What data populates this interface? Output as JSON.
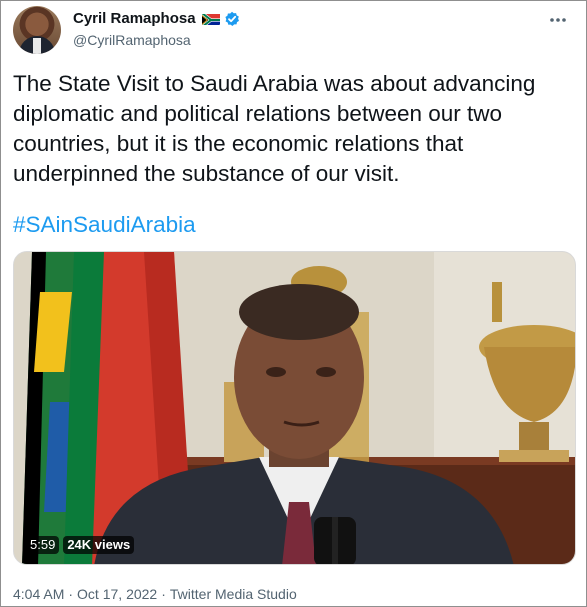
{
  "author": {
    "name": "Cyril Ramaphosa",
    "handle": "@CyrilRamaphosa",
    "flag_icon": "south-africa-flag-icon",
    "verified_icon": "verified-badge-icon"
  },
  "more_menu_icon": "more-options-icon",
  "tweet": {
    "text": "The State Visit to Saudi Arabia was about advancing diplomatic and political relations between our two countries, but it is the economic relations that underpinned the substance of our visit.",
    "hashtag": "#SAinSaudiArabia"
  },
  "media": {
    "duration": "5:59",
    "views": "24K views"
  },
  "meta": {
    "time": "4:04 AM",
    "separator1": "·",
    "date": "Oct 17, 2022",
    "separator2": "·",
    "source": "Twitter Media Studio"
  },
  "colors": {
    "link": "#1d9bf0",
    "secondary_text": "#536471",
    "verified": "#1d9bf0"
  }
}
